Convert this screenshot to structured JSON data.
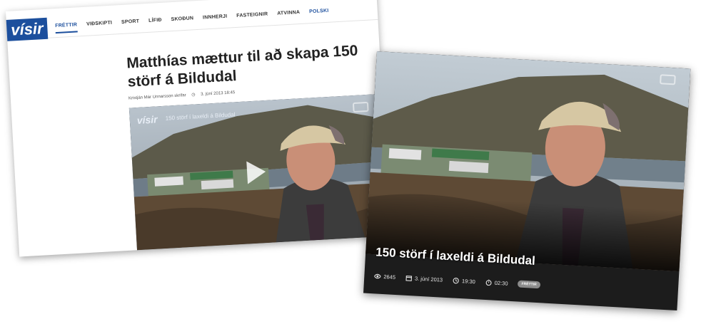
{
  "article": {
    "logo": "vísir",
    "nav": [
      "FRÉTTIR",
      "VIÐSKIPTI",
      "SPORT",
      "LÍFIÐ",
      "SKOÐUN",
      "INNHERJI",
      "FASTEIGNIR",
      "ATVINNA",
      "POLSKI"
    ],
    "headline": "Matthías mættur til að skapa 150 störf á Bildudal",
    "author": "Kristján Már Unnarsson skrifar",
    "date": "3. júní 2013 18:45",
    "video": {
      "logo": "vísir",
      "title": "150 störf í laxeldi á Bildudal"
    }
  },
  "video_page": {
    "title": "150 störf í laxeldi á Bildudal",
    "views": "2645",
    "date": "3. júní 2013",
    "time": "19:30",
    "duration": "02:30",
    "tag": "FRÉTTIR"
  },
  "colors": {
    "brand": "#1c4f9d",
    "dark_bg": "#1c1c1c"
  }
}
